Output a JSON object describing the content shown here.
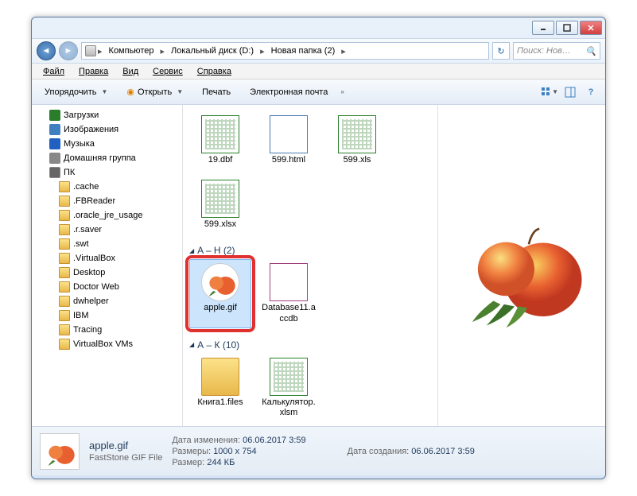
{
  "breadcrumbs": [
    "Компьютер",
    "Локальный диск (D:)",
    "Новая папка (2)"
  ],
  "search_placeholder": "Поиск: Нов…",
  "menu": {
    "file": "Файл",
    "edit": "Правка",
    "view": "Вид",
    "tools": "Сервис",
    "help": "Справка"
  },
  "toolbar": {
    "organize": "Упорядочить",
    "open": "Открыть",
    "print": "Печать",
    "email": "Электронная почта"
  },
  "tree": [
    {
      "label": "Загрузки",
      "icon": "downloads"
    },
    {
      "label": "Изображения",
      "icon": "pictures"
    },
    {
      "label": "Музыка",
      "icon": "music"
    },
    {
      "label": "Домашняя группа",
      "icon": "homegroup"
    },
    {
      "label": "ПК",
      "icon": "computer"
    },
    {
      "label": ".cache",
      "icon": "folder",
      "indent": 1
    },
    {
      "label": ".FBReader",
      "icon": "folder",
      "indent": 1
    },
    {
      "label": ".oracle_jre_usage",
      "icon": "folder",
      "indent": 1
    },
    {
      "label": ".r.saver",
      "icon": "folder",
      "indent": 1
    },
    {
      "label": ".swt",
      "icon": "folder",
      "indent": 1
    },
    {
      "label": ".VirtualBox",
      "icon": "folder",
      "indent": 1
    },
    {
      "label": "Desktop",
      "icon": "folder",
      "indent": 1
    },
    {
      "label": "Doctor Web",
      "icon": "folder",
      "indent": 1
    },
    {
      "label": "dwhelper",
      "icon": "folder",
      "indent": 1
    },
    {
      "label": "IBM",
      "icon": "folder",
      "indent": 1
    },
    {
      "label": "Tracing",
      "icon": "folder",
      "indent": 1
    },
    {
      "label": "VirtualBox VMs",
      "icon": "folder",
      "indent": 1
    }
  ],
  "groups": [
    {
      "header": "",
      "files": [
        {
          "name": "19.dbf",
          "type": "xls"
        },
        {
          "name": "599.html",
          "type": "html"
        },
        {
          "name": "599.xls",
          "type": "xls"
        },
        {
          "name": "599.xlsx",
          "type": "xls"
        }
      ]
    },
    {
      "header": "A – H (2)",
      "files": [
        {
          "name": "apple.gif",
          "type": "apple",
          "selected": true,
          "highlighted": true
        },
        {
          "name": "Database11.accdb",
          "type": "db"
        }
      ]
    },
    {
      "header": "А – К (10)",
      "files": [
        {
          "name": "Книга1.files",
          "type": "folder"
        },
        {
          "name": "Калькулятор.xlsm",
          "type": "xls"
        }
      ]
    }
  ],
  "details": {
    "name": "apple.gif",
    "type": "FastStone GIF File",
    "modified_label": "Дата изменения:",
    "modified": "06.06.2017 3:59",
    "dimensions_label": "Размеры:",
    "dimensions": "1000 x 754",
    "size_label": "Размер:",
    "size": "244 КБ",
    "created_label": "Дата создания:",
    "created": "06.06.2017 3:59"
  }
}
